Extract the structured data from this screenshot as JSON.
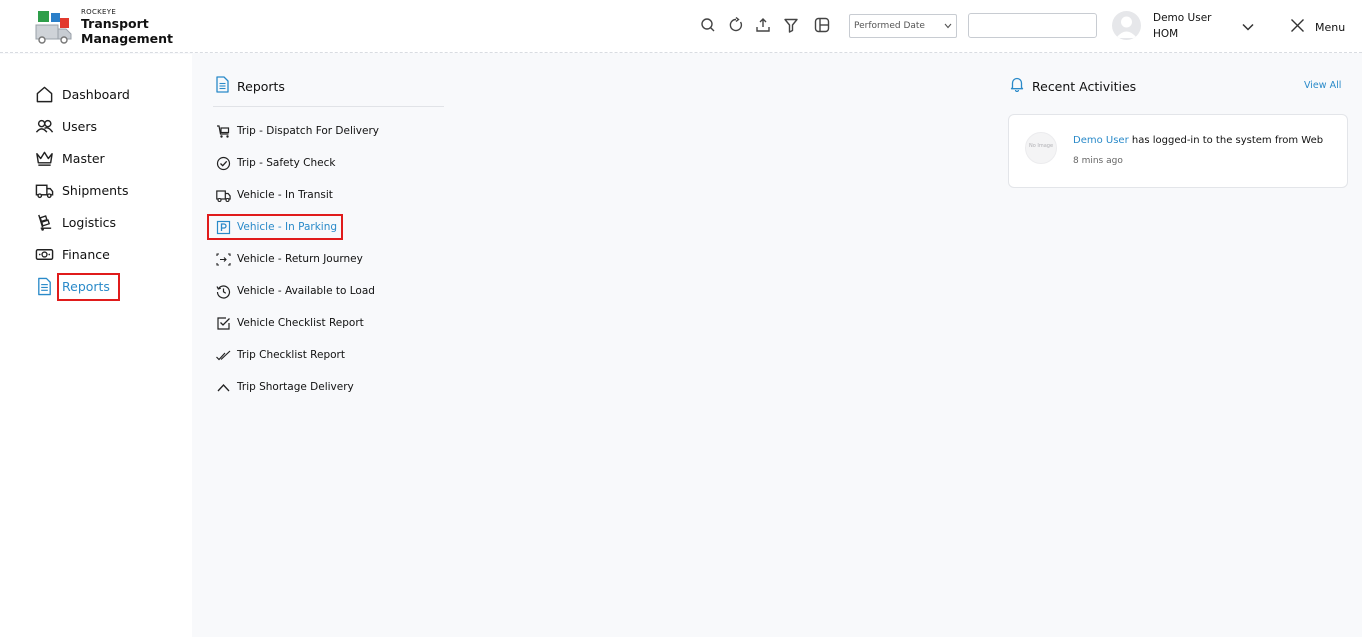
{
  "brand": {
    "small": "ROCKEYE",
    "line1": "Transport",
    "line2": "Management"
  },
  "header": {
    "date_select": "Performed Date",
    "search_value": "",
    "user_name": "Demo User",
    "user_org": "HOM",
    "menu_label": "Menu"
  },
  "sidebar": {
    "items": [
      {
        "label": "Dashboard",
        "icon": "home-icon"
      },
      {
        "label": "Users",
        "icon": "users-icon"
      },
      {
        "label": "Master",
        "icon": "crown-icon"
      },
      {
        "label": "Shipments",
        "icon": "truck-icon"
      },
      {
        "label": "Logistics",
        "icon": "hand-truck-icon"
      },
      {
        "label": "Finance",
        "icon": "money-icon"
      },
      {
        "label": "Reports",
        "icon": "document-icon"
      }
    ],
    "active": "Reports"
  },
  "reports": {
    "title": "Reports",
    "items": [
      {
        "label": "Trip - Dispatch For Delivery",
        "icon": "cart-icon"
      },
      {
        "label": "Trip - Safety Check",
        "icon": "check-circle-icon"
      },
      {
        "label": "Vehicle - In Transit",
        "icon": "truck-icon"
      },
      {
        "label": "Vehicle - In Parking",
        "icon": "parking-icon"
      },
      {
        "label": "Vehicle - Return Journey",
        "icon": "return-icon"
      },
      {
        "label": "Vehicle - Available to Load",
        "icon": "history-icon"
      },
      {
        "label": "Vehicle Checklist Report",
        "icon": "checkbox-icon"
      },
      {
        "label": "Trip Checklist Report",
        "icon": "double-check-icon"
      },
      {
        "label": "Trip Shortage Delivery",
        "icon": "triangle-icon"
      }
    ],
    "active": "Vehicle - In Parking"
  },
  "activities": {
    "title": "Recent Activities",
    "view_all": "View All",
    "items": [
      {
        "user": "Demo User",
        "text": " has logged-in to the system from Web",
        "time": "8 mins ago",
        "avatar_text": "No Image"
      }
    ]
  },
  "colors": {
    "accent": "#2a8ac9",
    "highlight": "#e01b1b"
  }
}
